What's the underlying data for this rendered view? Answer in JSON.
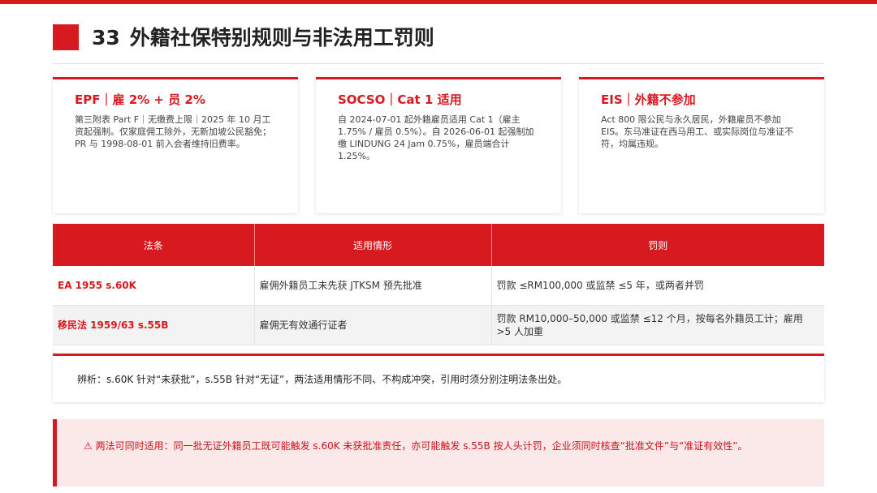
{
  "header": {
    "number": "33",
    "title": "外籍社保特别规则与非法用工罚则"
  },
  "cards": [
    {
      "heading": "EPF｜雇 2% + 员 2%",
      "body": "第三附表 Part F｜无缴费上限｜2025 年 10 月工资起强制。仅家庭佣工除外，无新加坡公民豁免；PR 与 1998-08-01 前入会者维持旧费率。"
    },
    {
      "heading": "SOCSO｜Cat 1 适用",
      "body": "自 2024-07-01 起外籍雇员适用 Cat 1（雇主 1.75% / 雇员 0.5%）。自 2026-06-01 起强制加缴 LINDUNG 24 Jam 0.75%，雇员端合计 1.25%。"
    },
    {
      "heading": "EIS｜外籍不参加",
      "body": "Act 800 限公民与永久居民，外籍雇员不参加 EIS。东马准证在西马用工、或实际岗位与准证不符，均属违规。"
    }
  ],
  "table": {
    "headers": [
      "法条",
      "适用情形",
      "罚则"
    ],
    "rows": [
      [
        "EA 1955 s.60K",
        "雇佣外籍员工未先获 JTKSM 预先批准",
        "罚款 ≤RM100,000 或监禁 ≤5 年，或两者并罚"
      ],
      [
        "移民法 1959/63 s.55B",
        "雇佣无有效通行证者",
        "罚款 RM10,000–50,000 或监禁 ≤12 个月，按每名外籍员工计；雇用 >5 人加重"
      ]
    ]
  },
  "note": "辨析：s.60K 针对“未获批”，s.55B 针对“无证”，两法适用情形不同、不构成冲突，引用时须分别注明法条出处。",
  "warning": "⚠ 两法可同时适用：同一批无证外籍员工既可能触发 s.60K 未获批准责任，亦可能触发 s.55B 按人头计罚，企业须同时核查“批准文件”与“准证有效性”。",
  "colors": {
    "accent": "#d71920",
    "warning_bg": "#fbe9ea"
  }
}
